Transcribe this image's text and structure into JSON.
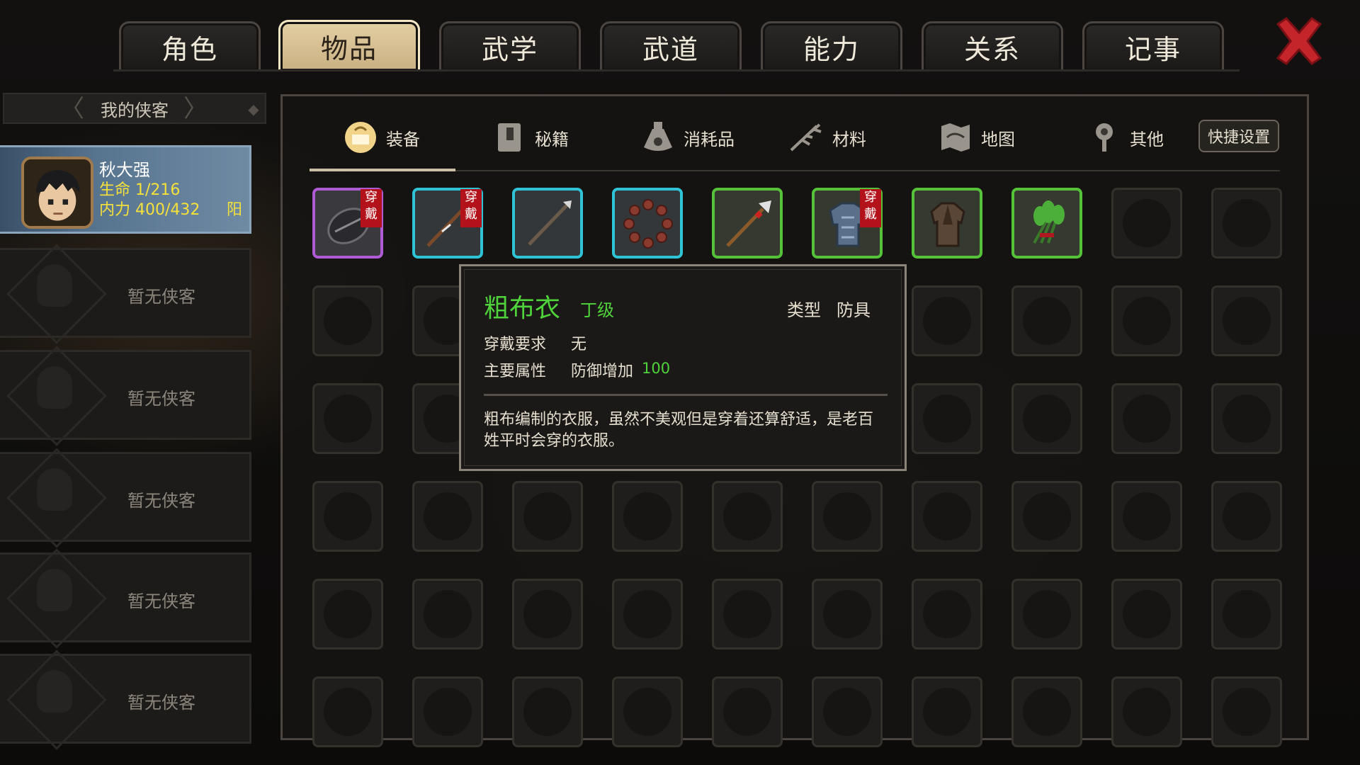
{
  "tabs": [
    {
      "label": "角色",
      "active": false
    },
    {
      "label": "物品",
      "active": true
    },
    {
      "label": "武学",
      "active": false
    },
    {
      "label": "武道",
      "active": false
    },
    {
      "label": "能力",
      "active": false
    },
    {
      "label": "关系",
      "active": false
    },
    {
      "label": "记事",
      "active": false
    }
  ],
  "close_icon": "close-x-icon",
  "colors": {
    "accent_red": "#c4252b",
    "tab_active": "#d8c39a",
    "hero_card": "#587590",
    "green_text": "#4fd33a",
    "stat_yellow": "#f5e13a"
  },
  "party": {
    "title": "我的侠客",
    "hero": {
      "name": "秋大强",
      "hp": "生命 1/216",
      "mp": "内力 400/432",
      "alignment": "阳"
    },
    "empty_label": "暂无侠客",
    "empty_slots": [
      "暂无侠客",
      "暂无侠客",
      "暂无侠客",
      "暂无侠客",
      "暂无侠客"
    ]
  },
  "categories": [
    {
      "label": "装备",
      "icon": "equipment-icon",
      "active": true
    },
    {
      "label": "秘籍",
      "icon": "book-icon",
      "active": false
    },
    {
      "label": "消耗品",
      "icon": "potion-icon",
      "active": false
    },
    {
      "label": "材料",
      "icon": "herb-icon",
      "active": false
    },
    {
      "label": "地图",
      "icon": "map-icon",
      "active": false
    },
    {
      "label": "其他",
      "icon": "misc-icon",
      "active": false
    }
  ],
  "quick_settings": "快捷设置",
  "items": [
    {
      "icon": "round-shield-icon",
      "rarity": "purple",
      "worn": "穿戴"
    },
    {
      "icon": "spear-icon",
      "rarity": "cyan",
      "worn": "穿戴"
    },
    {
      "icon": "staff-icon",
      "rarity": "cyan",
      "worn": ""
    },
    {
      "icon": "prayer-beads-icon",
      "rarity": "cyan",
      "worn": ""
    },
    {
      "icon": "spear-red-icon",
      "rarity": "green",
      "worn": ""
    },
    {
      "icon": "armor-icon",
      "rarity": "green",
      "worn": "穿戴"
    },
    {
      "icon": "cloth-robe-icon",
      "rarity": "green",
      "worn": ""
    },
    {
      "icon": "herb-bundle-icon",
      "rarity": "green",
      "worn": ""
    }
  ],
  "tooltip": {
    "name": "粗布衣",
    "grade": "丁级",
    "type_label": "类型",
    "type_value": "防具",
    "req_label": "穿戴要求",
    "req_value": "无",
    "attr_label": "主要属性",
    "attr_value": "防御增加",
    "attr_number": "100",
    "description": "粗布编制的衣服，虽然不美观但是穿着还算舒适，是老百姓平时会穿的衣服。"
  }
}
